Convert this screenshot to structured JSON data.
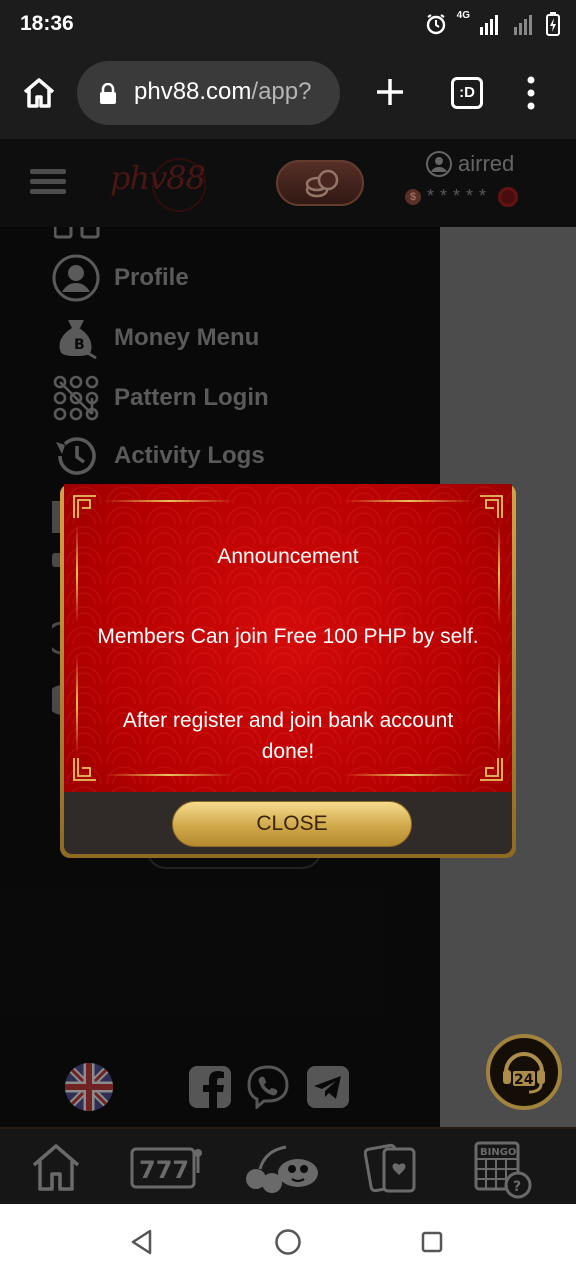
{
  "status_bar": {
    "time": "18:36",
    "network": "4G"
  },
  "browser": {
    "url_domain": "phv88.com",
    "url_path": "/app?",
    "tabs_count": ":D"
  },
  "header": {
    "logo_text": "phv88",
    "username": "airred",
    "masked_balance": "*****"
  },
  "drawer": {
    "items": [
      {
        "label": "Profile",
        "icon": "profile-icon"
      },
      {
        "label": "Money Menu",
        "icon": "money-bag-icon"
      },
      {
        "label": "Pattern Login",
        "icon": "pattern-grid-icon"
      },
      {
        "label": "Activity Logs",
        "icon": "history-icon"
      }
    ]
  },
  "modal": {
    "title": "Announcement",
    "line1": "Members Can join Free 100 PHP by self.",
    "line2": "After register and join bank account done!",
    "close_label": "CLOSE"
  },
  "support": {
    "label": "24"
  },
  "colors": {
    "modal_red": "#c00000",
    "gold": "#d3a349",
    "panel_bg": "#0c0c0c"
  }
}
